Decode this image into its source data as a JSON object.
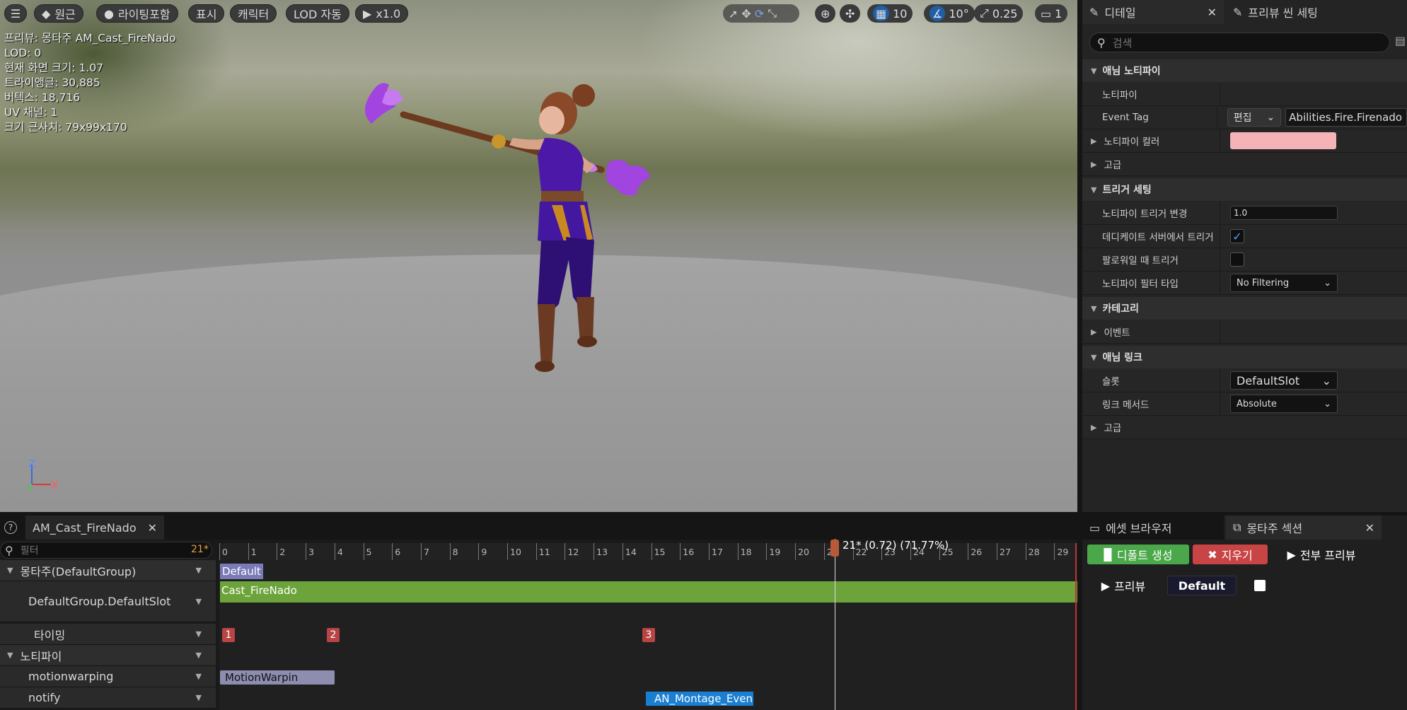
{
  "viewport": {
    "toolbar_left": [
      {
        "id": "menu",
        "label": ""
      },
      {
        "id": "perspective",
        "label": "원근"
      },
      {
        "id": "lighting",
        "label": "라이팅포함"
      },
      {
        "id": "show",
        "label": "표시"
      },
      {
        "id": "character",
        "label": "캐릭터"
      },
      {
        "id": "lod",
        "label": "LOD 자동"
      },
      {
        "id": "play",
        "label": "x1.0"
      }
    ],
    "toolbar_right": {
      "grid": "10",
      "angle": "10°",
      "scale": "0.25",
      "camera": "1"
    },
    "info": [
      "프리뷰: 몽타주 AM_Cast_FireNado",
      "LOD: 0",
      "현재 화면 크기: 1.07",
      "트라이앵글: 30,885",
      "버텍스: 18,716",
      "UV 채널: 1",
      "크기 근사치: 79x99x170"
    ],
    "axis": {
      "z": "Z",
      "x": "X"
    }
  },
  "details": {
    "tabs": [
      {
        "label": "디테일"
      },
      {
        "label": "프리뷰 씬 세팅"
      }
    ],
    "search_placeholder": "검색",
    "sections": {
      "anim_notify": "애님 노티파이",
      "notify_label": "노티파이",
      "event_tag_label": "Event Tag",
      "event_tag_edit": "편집",
      "event_tag_value": "Abilities.Fire.Firenado",
      "notify_color_label": "노티파이 컬러",
      "notify_color": "#f4b3b6",
      "advanced1": "고급",
      "trigger_settings": "트리거 세팅",
      "trigger_change_label": "노티파이 트리거 변경",
      "trigger_change_value": "1.0",
      "dedicated_server_label": "데디케이트 서버에서 트리거",
      "dedicated_server_checked": true,
      "follower_label": "팔로워일 때 트리거",
      "follower_checked": false,
      "filter_type_label": "노티파이 필터 타입",
      "filter_type_value": "No Filtering",
      "category": "카테고리",
      "event_label": "이벤트",
      "anim_link": "애님 링크",
      "slot_label": "슬롯",
      "slot_value": "DefaultSlot",
      "link_method_label": "링크 메서드",
      "link_method_value": "Absolute",
      "advanced2": "고급"
    }
  },
  "timeline": {
    "tab": "AM_Cast_FireNado",
    "filter_placeholder": "필터",
    "frame_counter": "21*",
    "playhead_label": "21* (0.72) (71.77%)",
    "ticks": [
      "0",
      "1",
      "2",
      "3",
      "4",
      "5",
      "6",
      "7",
      "8",
      "9",
      "10",
      "11",
      "12",
      "13",
      "14",
      "15",
      "16",
      "17",
      "18",
      "19",
      "20",
      "21",
      "22",
      "23",
      "24",
      "25",
      "26",
      "27",
      "28",
      "29"
    ],
    "tracks": {
      "montage": "몽타주(DefaultGroup)",
      "slot": "DefaultGroup.DefaultSlot",
      "timing": "타이밍",
      "notifies": "노티파이",
      "motionwarping": "motionwarping",
      "notify": "notify"
    },
    "section_default": "Default",
    "clip_name": "Cast_FireNado",
    "markers": [
      "1",
      "2",
      "3"
    ],
    "motionwarp_clip": "MotionWarpin",
    "notify_clip": "AN_Montage_Even"
  },
  "bottom_right": {
    "tabs": [
      {
        "label": "에셋 브라우저"
      },
      {
        "label": "몽타주 섹션"
      }
    ],
    "create_default": "디폴트 생성",
    "clear": "지우기",
    "preview_all": "전부 프리뷰",
    "preview": "프리뷰",
    "section_default": "Default"
  }
}
